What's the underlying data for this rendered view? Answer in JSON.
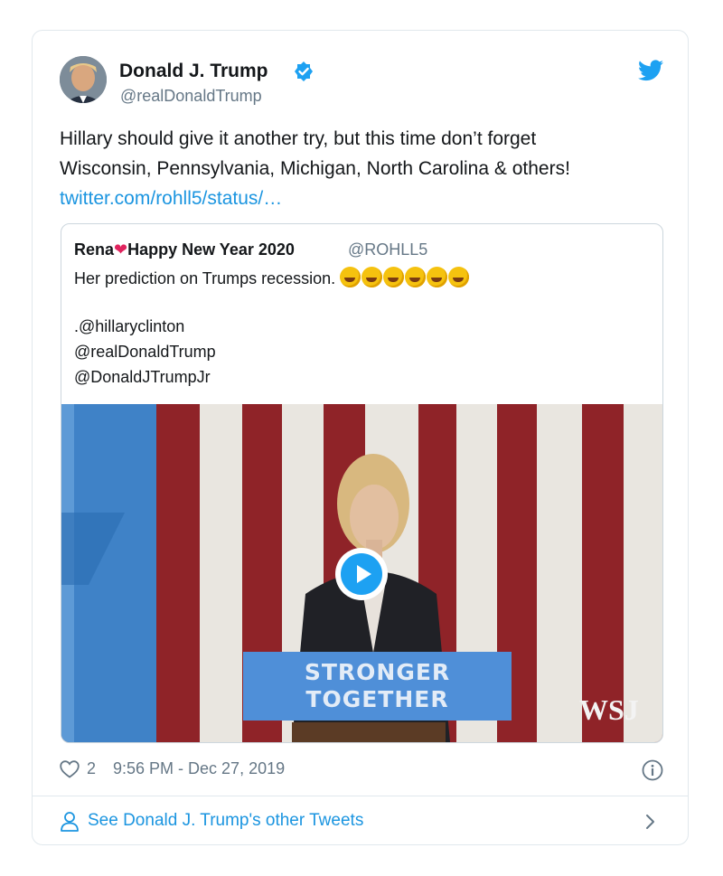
{
  "tweet": {
    "author_name": "Donald J. Trump",
    "author_handle": "@realDonaldTrump",
    "text_line_1": "Hillary should give it another try, but this time don’t forget",
    "text_line_2": "Wisconsin, Pennsylvania, Michigan, North Carolina & others!",
    "link_text": "twitter.com/rohll5/status/…",
    "like_count": "2",
    "timestamp": "9:56 PM - Dec 27, 2019"
  },
  "quoted_tweet": {
    "name_part_1": "Rena",
    "name_part_2": "Happy New Year 2020",
    "handle": "@ROHLL5",
    "text": "Her prediction on Trumps recession.",
    "mentions": [
      ".@hillaryclinton",
      "@realDonaldTrump",
      "@DonaldJTrumpJr"
    ],
    "media": {
      "sign_line_1": "STRONGER",
      "sign_line_2": "TOGETHER",
      "watermark": "WSJ"
    }
  },
  "footer": {
    "other_tweets_label": "See Donald J. Trump's other Tweets"
  },
  "colors": {
    "link": "#1b95e0",
    "verified": "#1da1f2",
    "muted": "#657786",
    "border": "#e1e8ed"
  },
  "icons": [
    "verified-badge-icon",
    "twitter-bird-icon",
    "heart-icon",
    "info-icon",
    "person-icon",
    "chevron-right-icon",
    "play-icon"
  ]
}
